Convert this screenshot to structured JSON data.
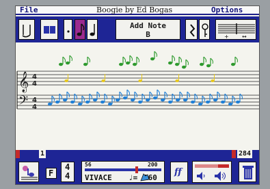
{
  "menu": {
    "file": "File",
    "title": "Boogie by Ed Bogas",
    "options": "Options"
  },
  "toolbar": {
    "add_note_line1": "Add Note",
    "add_note_line2": "B"
  },
  "position": {
    "start": "1",
    "end": "284"
  },
  "bottom": {
    "key_label": "F",
    "time_sig_top": "4",
    "time_sig_bottom": "4",
    "tempo_min": "56",
    "tempo_max": "200",
    "tempo_name": "VIVACE",
    "tempo_value": "160",
    "dynamics": "ff"
  },
  "colors": {
    "accent": "#1e2595",
    "red": "#c52a2a",
    "treble_notes": "#2e9a2e",
    "bass_notes": "#1f7fd6",
    "highlight": "#e8c81a"
  }
}
